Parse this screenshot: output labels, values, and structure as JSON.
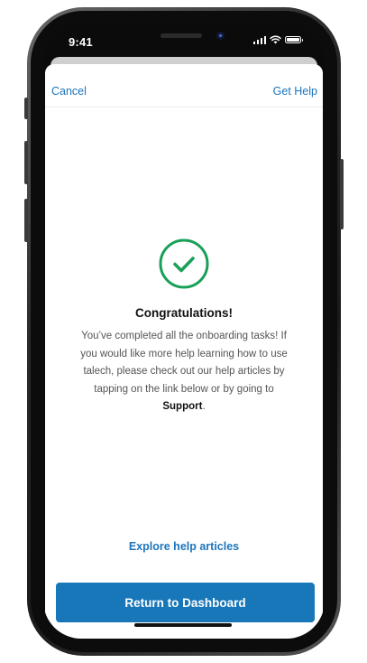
{
  "status_bar": {
    "time": "9:41",
    "icons": [
      "signal-icon",
      "wifi-icon",
      "battery-icon"
    ]
  },
  "nav": {
    "cancel_label": "Cancel",
    "help_label": "Get Help"
  },
  "success": {
    "icon": "check-circle-icon",
    "icon_color": "#18a058",
    "title": "Congratulations!",
    "message_before": "You’ve completed all the onboarding tasks! If you would like more help learning how to use talech, please check out our help articles by tapping on the link below or by going to",
    "message_link": "Support",
    "message_after": "."
  },
  "actions": {
    "explore_label": "Explore help articles",
    "dashboard_button_label": "Return to Dashboard"
  },
  "colors": {
    "accent": "#1c75bc",
    "button": "#1877b8",
    "success": "#18a058"
  }
}
